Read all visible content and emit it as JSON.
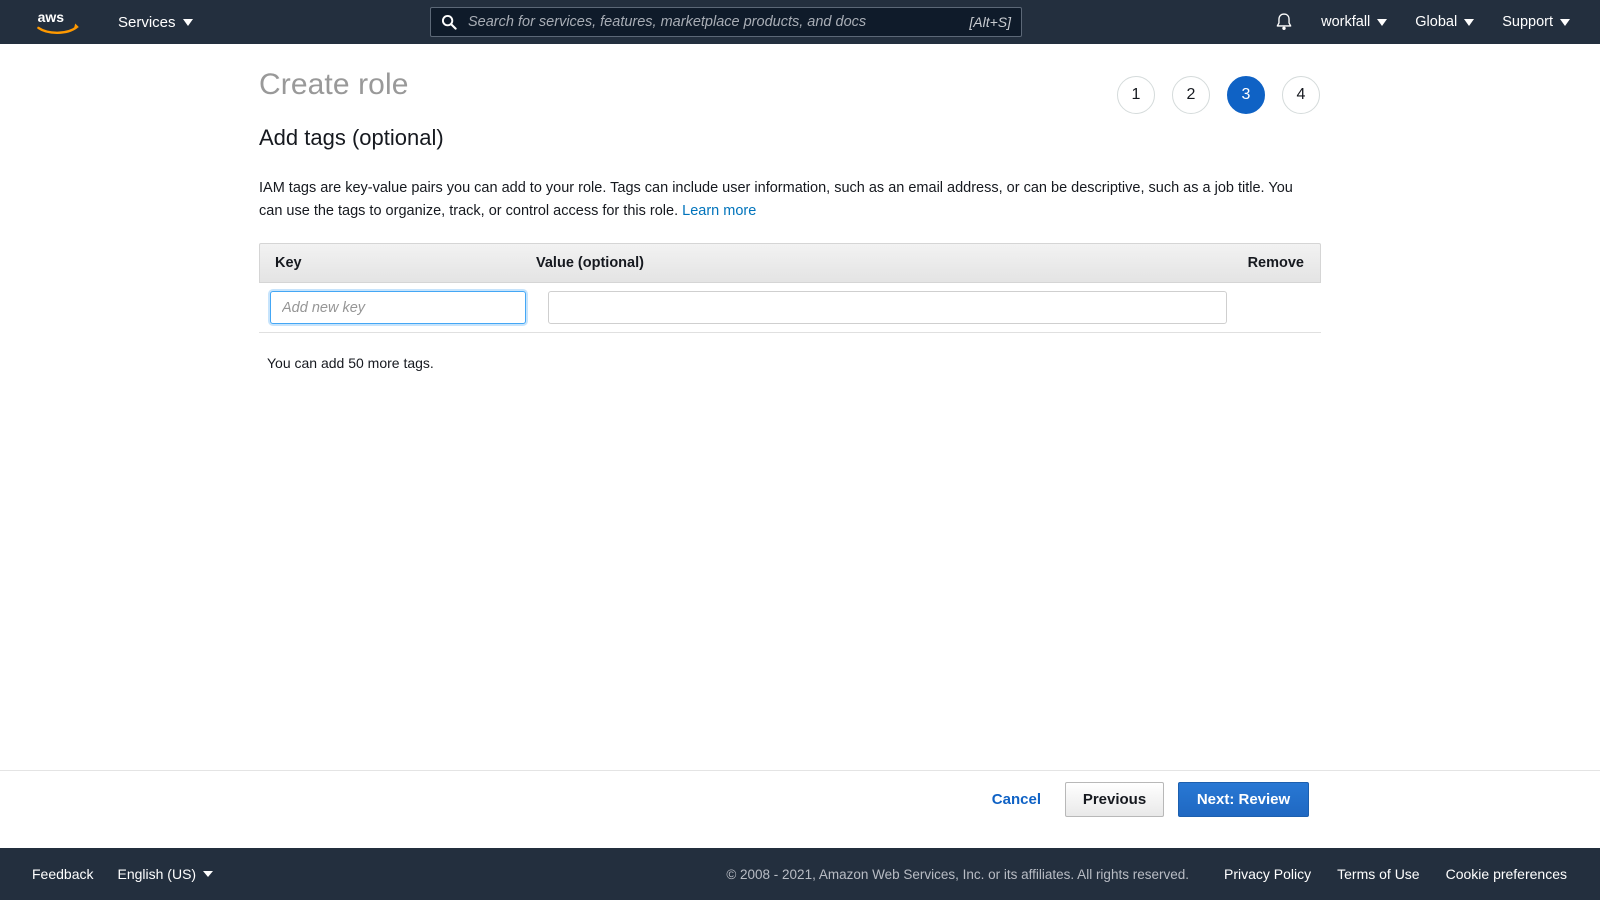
{
  "topnav": {
    "logo_alt": "aws",
    "services_label": "Services",
    "search": {
      "placeholder": "Search for services, features, marketplace products, and docs",
      "value": "",
      "shortcut": "[Alt+S]"
    },
    "account_label": "workfall",
    "region_label": "Global",
    "support_label": "Support"
  },
  "page": {
    "title": "Create role",
    "section_title": "Add tags (optional)",
    "description_before_link": "IAM tags are key-value pairs you can add to your role. Tags can include user information, such as an email address, or can be descriptive, such as a job title. You can use the tags to organize, track, or control access for this role. ",
    "learn_more_label": "Learn more",
    "steps": [
      {
        "number": "1",
        "active": false
      },
      {
        "number": "2",
        "active": false
      },
      {
        "number": "3",
        "active": true
      },
      {
        "number": "4",
        "active": false
      }
    ]
  },
  "tags_table": {
    "headers": {
      "key": "Key",
      "value": "Value (optional)",
      "remove": "Remove"
    },
    "rows": [
      {
        "key_value": "",
        "key_placeholder": "Add new key",
        "value_value": "",
        "value_placeholder": ""
      }
    ],
    "note": "You can add 50 more tags."
  },
  "actions": {
    "cancel_label": "Cancel",
    "previous_label": "Previous",
    "next_label": "Next: Review"
  },
  "footer": {
    "feedback_label": "Feedback",
    "language_label": "English (US)",
    "copyright": "© 2008 - 2021, Amazon Web Services, Inc. or its affiliates. All rights reserved.",
    "privacy_label": "Privacy Policy",
    "terms_label": "Terms of Use",
    "cookie_label": "Cookie preferences"
  },
  "colors": {
    "nav_bg": "#232f3e",
    "accent_blue": "#0f62c5",
    "link_blue": "#0073bb",
    "focus_blue": "#44a7f5"
  }
}
